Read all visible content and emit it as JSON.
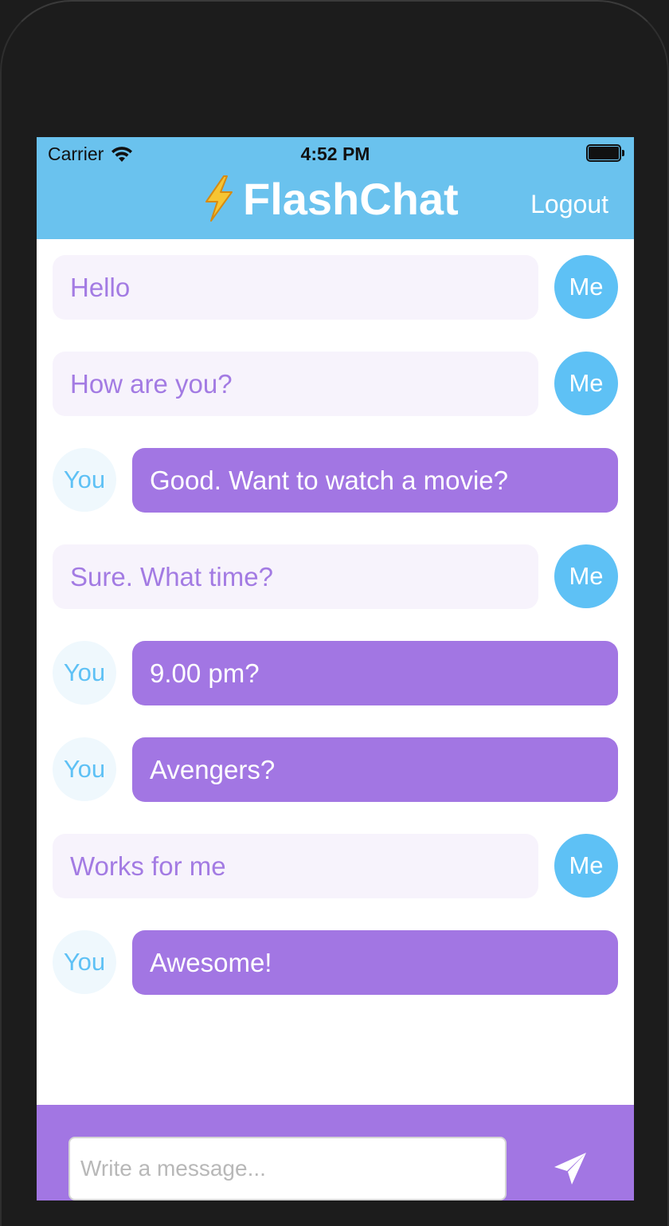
{
  "status_bar": {
    "carrier": "Carrier",
    "time": "4:52 PM"
  },
  "navbar": {
    "title": "FlashChat",
    "logout_label": "Logout",
    "background_color": "#6ac2ee"
  },
  "messages": [
    {
      "sender": "me",
      "avatar_label": "Me",
      "text": "Hello"
    },
    {
      "sender": "me",
      "avatar_label": "Me",
      "text": "How are you?"
    },
    {
      "sender": "you",
      "avatar_label": "You",
      "text": "Good. Want to watch a movie?"
    },
    {
      "sender": "me",
      "avatar_label": "Me",
      "text": "Sure. What time?"
    },
    {
      "sender": "you",
      "avatar_label": "You",
      "text": "9.00 pm?"
    },
    {
      "sender": "you",
      "avatar_label": "You",
      "text": "Avengers?"
    },
    {
      "sender": "me",
      "avatar_label": "Me",
      "text": "Works for me"
    },
    {
      "sender": "you",
      "avatar_label": "You",
      "text": "Awesome!"
    }
  ],
  "composer": {
    "placeholder": "Write a message...",
    "background_color": "#a276e3"
  },
  "colors": {
    "me_bubble": "#f7f3fc",
    "me_text": "#a37be3",
    "me_avatar": "#5ec1f5",
    "you_bubble": "#a276e3",
    "you_avatar": "#eff8fd"
  }
}
